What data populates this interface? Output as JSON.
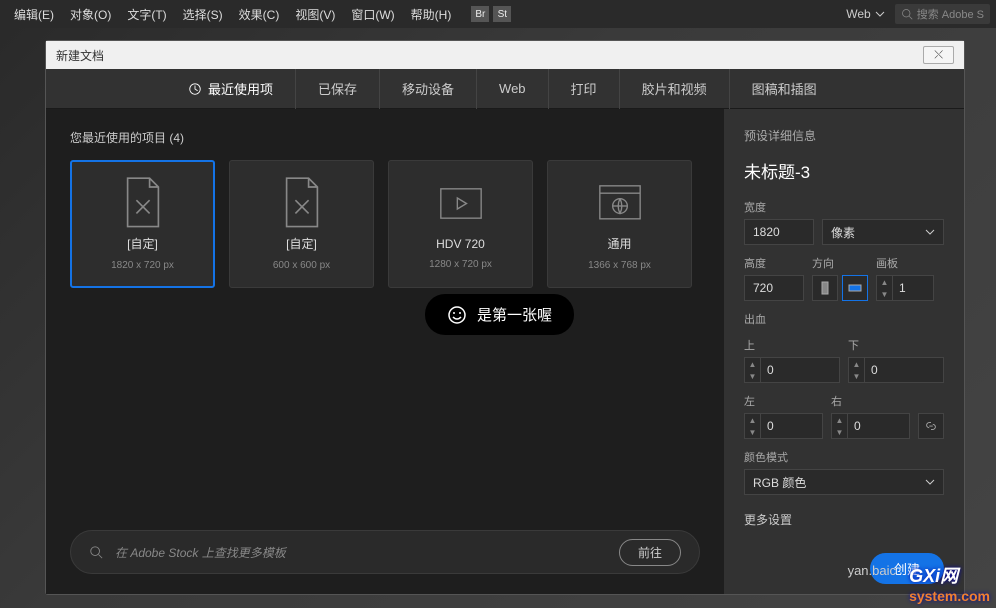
{
  "menubar": {
    "items": [
      "编辑(E)",
      "对象(O)",
      "文字(T)",
      "选择(S)",
      "效果(C)",
      "视图(V)",
      "窗口(W)",
      "帮助(H)"
    ],
    "badges": [
      "Br",
      "St"
    ],
    "workspace": "Web",
    "search_placeholder": "搜索 Adobe S"
  },
  "dialog": {
    "title": "新建文档",
    "close_glyph": "⤬",
    "tabs": [
      "最近使用项",
      "已保存",
      "移动设备",
      "Web",
      "打印",
      "胶片和视频",
      "图稿和插图"
    ],
    "section_title": "您最近使用的项目 (4)",
    "templates": [
      {
        "name": "[自定]",
        "dims": "1820 x 720 px",
        "icon": "doc-custom"
      },
      {
        "name": "[自定]",
        "dims": "600 x 600 px",
        "icon": "doc-custom"
      },
      {
        "name": "HDV 720",
        "dims": "1280 x 720 px",
        "icon": "video"
      },
      {
        "name": "通用",
        "dims": "1366 x 768 px",
        "icon": "web"
      }
    ],
    "tooltip": "是第一张喔",
    "stock": {
      "placeholder": "在 Adobe Stock 上查找更多模板",
      "go": "前往"
    },
    "footer": {
      "create": "创建"
    }
  },
  "preset": {
    "heading": "预设详细信息",
    "title": "未标题-3",
    "width_label": "宽度",
    "width": "1820",
    "unit": "像素",
    "height_label": "高度",
    "height": "720",
    "orient_label": "方向",
    "artboard_label": "画板",
    "artboards": "1",
    "bleed_label": "出血",
    "bleed": {
      "top_label": "上",
      "top": "0",
      "bottom_label": "下",
      "bottom": "0",
      "left_label": "左",
      "left": "0",
      "right_label": "右",
      "right": "0"
    },
    "colormode_label": "颜色模式",
    "colormode": "RGB 颜色",
    "more": "更多设置"
  },
  "watermark": {
    "brand": "GXi",
    "suffix": "网",
    "domain": "system.com",
    "sub": "yan.baic"
  }
}
